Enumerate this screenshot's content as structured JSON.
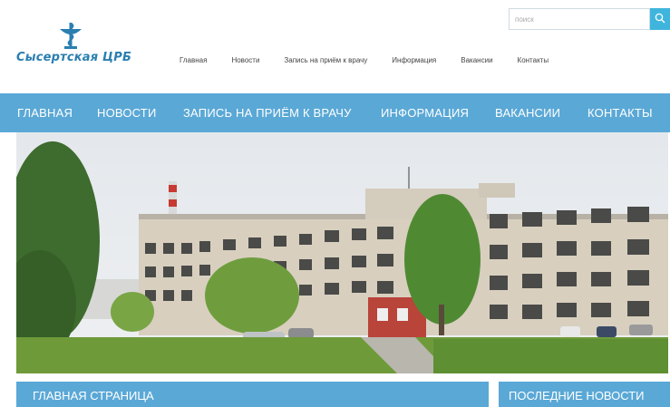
{
  "logo": {
    "text": "Сысертская ЦРБ",
    "emblem_icon": "caduceus-bowl-icon",
    "color": "#2a7fb0"
  },
  "search": {
    "placeholder": "поиск",
    "button_icon": "search-icon",
    "button_color": "#3fb5dd"
  },
  "top_nav": {
    "items": [
      {
        "label": "Главная"
      },
      {
        "label": "Новости"
      },
      {
        "label": "Запись на приём к врачу"
      },
      {
        "label": "Информация"
      },
      {
        "label": "Вакансии"
      },
      {
        "label": "Контакты"
      }
    ]
  },
  "main_nav": {
    "color": "#5aa8d6",
    "items": [
      {
        "label": "ГЛАВНАЯ"
      },
      {
        "label": "НОВОСТИ"
      },
      {
        "label": "ЗАПИСЬ НА ПРИЁМ К ВРАЧУ"
      },
      {
        "label": "ИНФОРМАЦИЯ"
      },
      {
        "label": "ВАКАНСИИ"
      },
      {
        "label": "КОНТАКТЫ"
      }
    ]
  },
  "sections": {
    "main_title": "ГЛАВНАЯ СТРАНИЦА",
    "news_title": "ПОСЛЕДНИЕ НОВОСТИ"
  }
}
